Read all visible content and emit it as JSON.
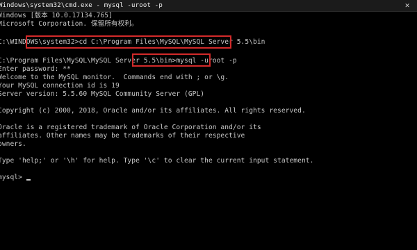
{
  "window": {
    "title": "Windows\\system32\\cmd.exe - mysql -uroot -p",
    "close_icon": "close-icon"
  },
  "console": {
    "lines": [
      "Windows [版本 10.0.17134.765]",
      "Microsoft Corporation. 保留所有权利。",
      "",
      "C:\\WINDOWS\\system32>cd C:\\Program Files\\MySQL\\MySQL Server 5.5\\bin",
      "",
      "C:\\Program Files\\MySQL\\MySQL Server 5.5\\bin>mysql -uroot -p",
      "Enter password: **",
      "Welcome to the MySQL monitor.  Commands end with ; or \\g.",
      "Your MySQL connection id is 19",
      "Server version: 5.5.60 MySQL Community Server (GPL)",
      "",
      "Copyright (c) 2000, 2018, Oracle and/or its affiliates. All rights reserved.",
      "",
      "Oracle is a registered trademark of Oracle Corporation and/or its",
      "affiliates. Other names may be trademarks of their respective",
      "owners.",
      "",
      "Type 'help;' or '\\h' for help. Type '\\c' to clear the current input statement.",
      "",
      "mysql> "
    ]
  },
  "colors": {
    "background": "#000000",
    "text": "#c8c8c8",
    "highlight": "#d32a2a"
  }
}
